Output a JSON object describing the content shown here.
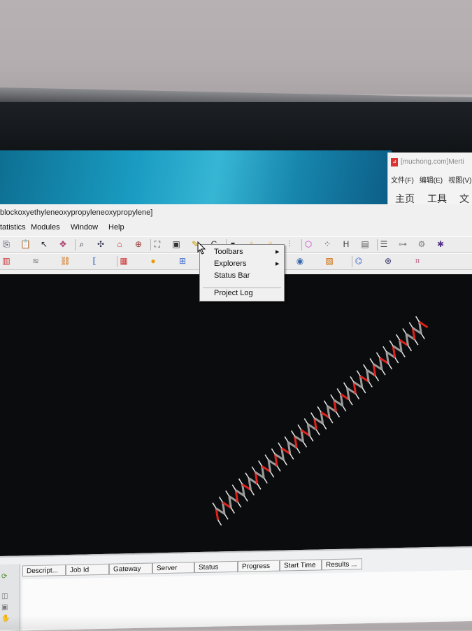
{
  "pdf_window": {
    "title": "[muchong.com]Merti",
    "menu": [
      "文件(F)",
      "编辑(E)",
      "视图(V)"
    ],
    "tabs": [
      "主页",
      "工具",
      "文"
    ]
  },
  "app": {
    "title": "blockoxyethyleneoxypropyleneoxypropylene]",
    "menu": [
      "tatistics",
      "Modules",
      "Window",
      "Help"
    ]
  },
  "toolbar1_icons": [
    "copy-icon",
    "paste-icon",
    "select-arrow-icon",
    "translate-icon",
    "zoom-icon",
    "move-icon",
    "home-icon",
    "center-icon",
    "fit-icon",
    "snapshot-icon",
    "pencil-icon",
    "carbon-element-icon",
    "dropdown-icon",
    "flame-icon",
    "flame-icon",
    "bond-icon",
    "ring-icon",
    "dot-grid-icon",
    "hydrogen-icon",
    "panel-icon",
    "list-icon",
    "hierarchy-icon",
    "gear-icon",
    "network-icon"
  ],
  "toolbar2_icons": [
    "display-icon",
    "wave-icon",
    "chain-icon",
    "bracket-icon",
    "square-icon",
    "sphere-icon",
    "grid-icon",
    "g-icon",
    "target-icon",
    "paint-icon",
    "circle-icon",
    "image-icon",
    "molecule-icon",
    "structure-icon",
    "lattice-icon"
  ],
  "context_menu": {
    "items": [
      {
        "label": "Toolbars",
        "submenu": true
      },
      {
        "label": "Explorers",
        "submenu": true
      },
      {
        "label": "Status Bar",
        "submenu": false
      },
      {
        "label": "Project Log",
        "submenu": false
      }
    ]
  },
  "jobs_table": {
    "columns": [
      "Descript...",
      "Job Id",
      "Gateway",
      "Server",
      "Status",
      "Progress",
      "Start Time",
      "Results ..."
    ]
  },
  "colors": {
    "viewport_bg": "#0b0c0d",
    "carbon": "#9a9a9a",
    "oxygen": "#e0201a",
    "hydrogen": "#e8e8e8"
  }
}
